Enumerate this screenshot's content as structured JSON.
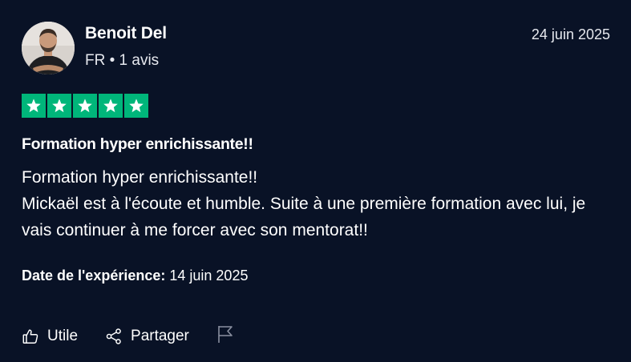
{
  "reviewer": {
    "name": "Benoit Del",
    "country": "FR",
    "separator": "•",
    "review_count": "1 avis"
  },
  "review": {
    "date": "24 juin 2025",
    "rating": 5,
    "star_color": "#00b67a",
    "title": "Formation hyper enrichissante!!",
    "body_lines": [
      "Formation hyper enrichissante!!",
      "Mickaël est à l'écoute et humble. Suite à une première formation avec lui, je vais continuer à me forcer avec son mentorat!!"
    ],
    "experience_label": "Date de l'expérience:",
    "experience_date": "14 juin 2025"
  },
  "actions": {
    "useful_label": "Utile",
    "share_label": "Partager",
    "useful_icon": "thumbs-up-icon",
    "share_icon": "share-icon",
    "report_icon": "flag-icon"
  }
}
